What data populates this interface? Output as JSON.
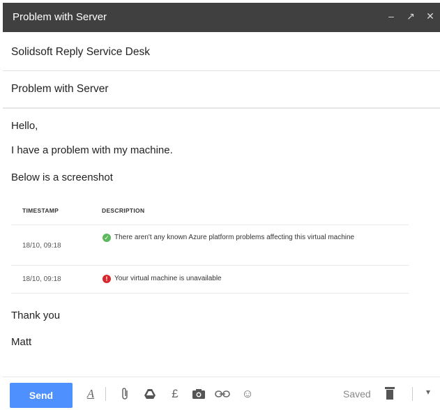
{
  "window": {
    "title": "Problem with Server"
  },
  "compose": {
    "to": "Solidsoft Reply Service Desk",
    "subject": "Problem with Server",
    "body": {
      "greeting": "Hello,",
      "line1": "I have a problem with my machine.",
      "line2": "Below is a screenshot",
      "closing": "Thank you",
      "signature": "Matt"
    }
  },
  "screenshot": {
    "headers": {
      "timestamp": "TIMESTAMP",
      "description": "DESCRIPTION"
    },
    "rows": [
      {
        "timestamp": "18/10, 09:18",
        "status": "ok",
        "description": "There aren't any known Azure platform problems affecting this virtual machine"
      },
      {
        "timestamp": "18/10, 09:18",
        "status": "error",
        "description": "Your virtual machine is unavailable"
      }
    ]
  },
  "toolbar": {
    "send_label": "Send",
    "saved_label": "Saved",
    "icons": [
      "formatting-icon",
      "attach-icon",
      "drive-icon",
      "currency-icon",
      "camera-icon",
      "link-icon",
      "emoji-icon",
      "trash-icon",
      "more-options-icon"
    ]
  },
  "colors": {
    "titlebar": "#404040",
    "send_button": "#4d90fe",
    "ok": "#5cb85c",
    "error": "#d9262c"
  }
}
